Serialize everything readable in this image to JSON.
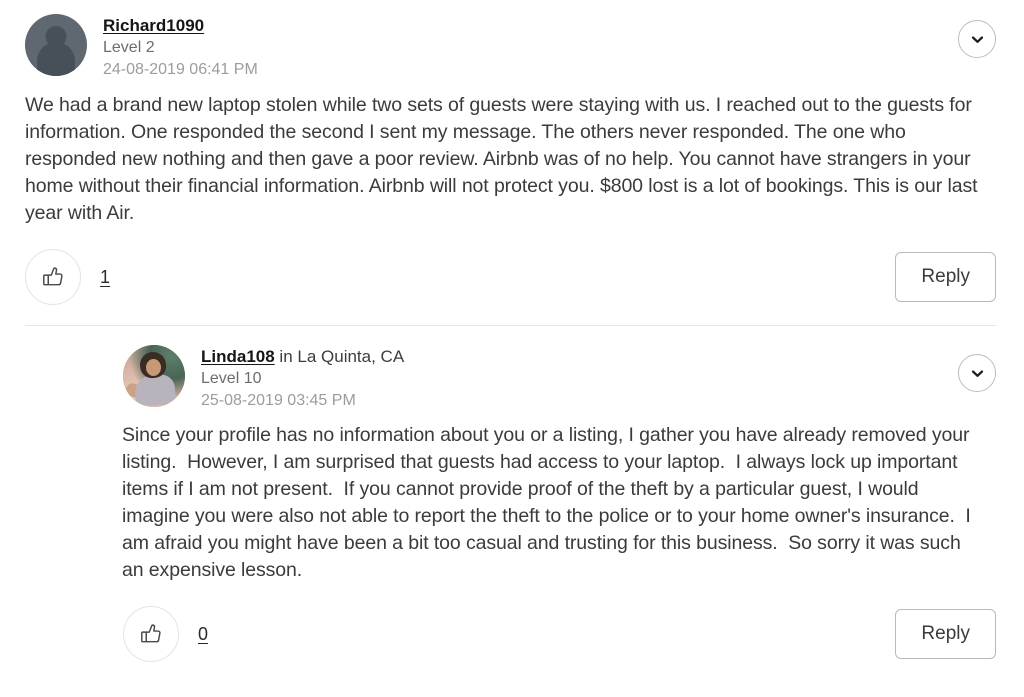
{
  "posts": [
    {
      "avatar_type": "silhouette",
      "username": "Richard1090",
      "location": "",
      "level": "Level 2",
      "timestamp": "24-08-2019 06:41 PM",
      "body": "We had a brand new laptop stolen while two sets of guests were staying with us. I reached out to the guests for information. One responded the second I sent my message. The others never responded. The one who responded new nothing and then gave a poor review. Airbnb was of no help. You cannot have strangers in your home without their financial information. Airbnb will not protect you. $800 lost is a lot of bookings. This is our last year with Air.",
      "like_count": "1",
      "reply_label": "Reply",
      "collapse_icon": "chevron-down-icon",
      "like_icon": "thumbs-up-icon"
    },
    {
      "avatar_type": "photo",
      "username": "Linda108",
      "location": " in La Quinta, CA",
      "level": "Level 10",
      "timestamp": "25-08-2019 03:45 PM",
      "body": "Since your profile has no information about you or a listing, I gather you have already removed your listing.  However, I am surprised that guests had access to your laptop.  I always lock up important items if I am not present.  If you cannot provide proof of the theft by a particular guest, I would imagine you were also not able to report the theft to the police or to your home owner's insurance.  I am afraid you might have been a bit too casual and trusting for this business.  So sorry it was such an expensive lesson.",
      "like_count": "0",
      "reply_label": "Reply",
      "collapse_icon": "chevron-down-icon",
      "like_icon": "thumbs-up-icon"
    }
  ],
  "colors": {
    "page_background": "#ffffff",
    "username_text": "#161616",
    "level_text": "#6c6c6c",
    "timestamp_text": "#9c9c9c",
    "body_text": "#3b3b3b",
    "border": "#bdbdbd",
    "divider": "#e6e6e6"
  }
}
